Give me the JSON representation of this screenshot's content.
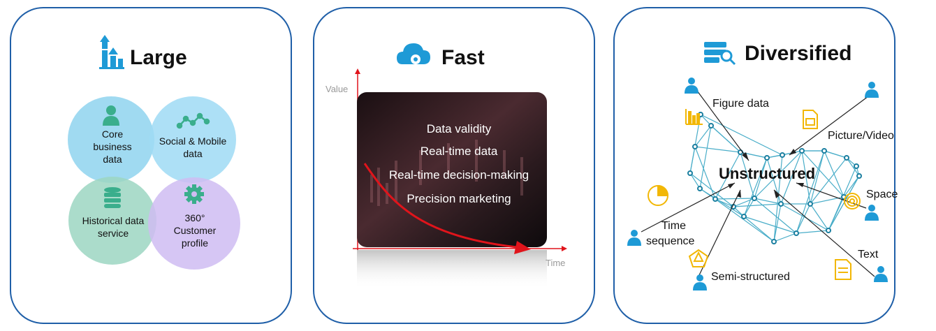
{
  "panels": {
    "large": {
      "title": "Large",
      "circles": [
        {
          "label": "Core business data",
          "icon": "person-icon",
          "color": "#7fd0ef"
        },
        {
          "label": "Social & Mobile data",
          "icon": "trend-line-icon",
          "color": "#8fd6f4"
        },
        {
          "label": "Historical data service",
          "icon": "database-icon",
          "color": "#8ccfb9"
        },
        {
          "label": "360° Customer profile",
          "icon": "gear-icon",
          "color": "#c9b3f0"
        }
      ]
    },
    "fast": {
      "title": "Fast",
      "y_axis": "Value",
      "x_axis": "Time",
      "items": [
        "Data validity",
        "Real-time data",
        "Real-time decision-making",
        "Precision marketing"
      ]
    },
    "diversified": {
      "title": "Diversified",
      "center": "Unstructured",
      "labels": {
        "figure": "Figure data",
        "picture": "Picture/Video",
        "space": "Space",
        "time1": "Time",
        "time2": "sequence",
        "text": "Text",
        "semi": "Semi-structured"
      }
    }
  },
  "colors": {
    "border": "#1f5fa8",
    "accent_blue": "#1e9ad6",
    "accent_yellow": "#f2b705",
    "arrow_red": "#e0141b",
    "network": "#2a9fbf"
  }
}
